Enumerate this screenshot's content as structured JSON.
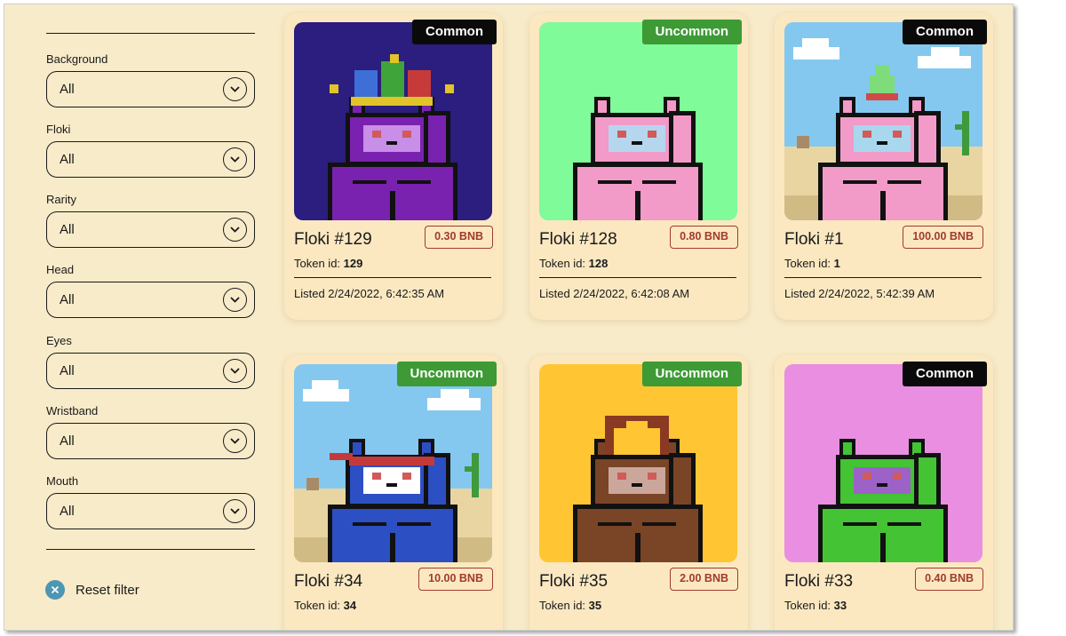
{
  "filters": {
    "items": [
      {
        "label": "Background",
        "value": "All"
      },
      {
        "label": "Floki",
        "value": "All"
      },
      {
        "label": "Rarity",
        "value": "All"
      },
      {
        "label": "Head",
        "value": "All"
      },
      {
        "label": "Eyes",
        "value": "All"
      },
      {
        "label": "Wristband",
        "value": "All"
      },
      {
        "label": "Mouth",
        "value": "All"
      }
    ],
    "reset_label": "Reset filter"
  },
  "cards": [
    {
      "rarity": "Common",
      "name": "Floki #129",
      "price": "0.30 BNB",
      "token_label": "Token id:",
      "token_id": "129",
      "listed": "Listed 2/24/2022, 6:42:35 AM",
      "bg": "#2b1e7e",
      "body": "#7a22b0",
      "face": "#c88ee8",
      "hat": "jester"
    },
    {
      "rarity": "Uncommon",
      "name": "Floki #128",
      "price": "0.80 BNB",
      "token_label": "Token id:",
      "token_id": "128",
      "listed": "Listed 2/24/2022, 6:42:08 AM",
      "bg": "#7ffb9a",
      "body": "#f29ac8",
      "face": "#b6d6ee",
      "hat": "none"
    },
    {
      "rarity": "Common",
      "name": "Floki #1",
      "price": "100.00 BNB",
      "token_label": "Token id:",
      "token_id": "1",
      "listed": "Listed 2/24/2022, 5:42:39 AM",
      "bg": "desert",
      "body": "#f29ac8",
      "face": "#a8d7ee",
      "hat": "party"
    },
    {
      "rarity": "Uncommon",
      "name": "Floki #34",
      "price": "10.00 BNB",
      "token_label": "Token id:",
      "token_id": "34",
      "listed": "",
      "bg": "desert",
      "body": "#2d4fc4",
      "face": "#ffffff",
      "hat": "headband"
    },
    {
      "rarity": "Uncommon",
      "name": "Floki #35",
      "price": "2.00 BNB",
      "token_label": "Token id:",
      "token_id": "35",
      "listed": "",
      "bg": "#ffc533",
      "body": "#7a4427",
      "face": "#caa79a",
      "hat": "helmet"
    },
    {
      "rarity": "Common",
      "name": "Floki #33",
      "price": "0.40 BNB",
      "token_label": "Token id:",
      "token_id": "33",
      "listed": "",
      "bg": "#e98ee0",
      "body": "#44c334",
      "face": "#9c62c8",
      "hat": "none"
    }
  ]
}
